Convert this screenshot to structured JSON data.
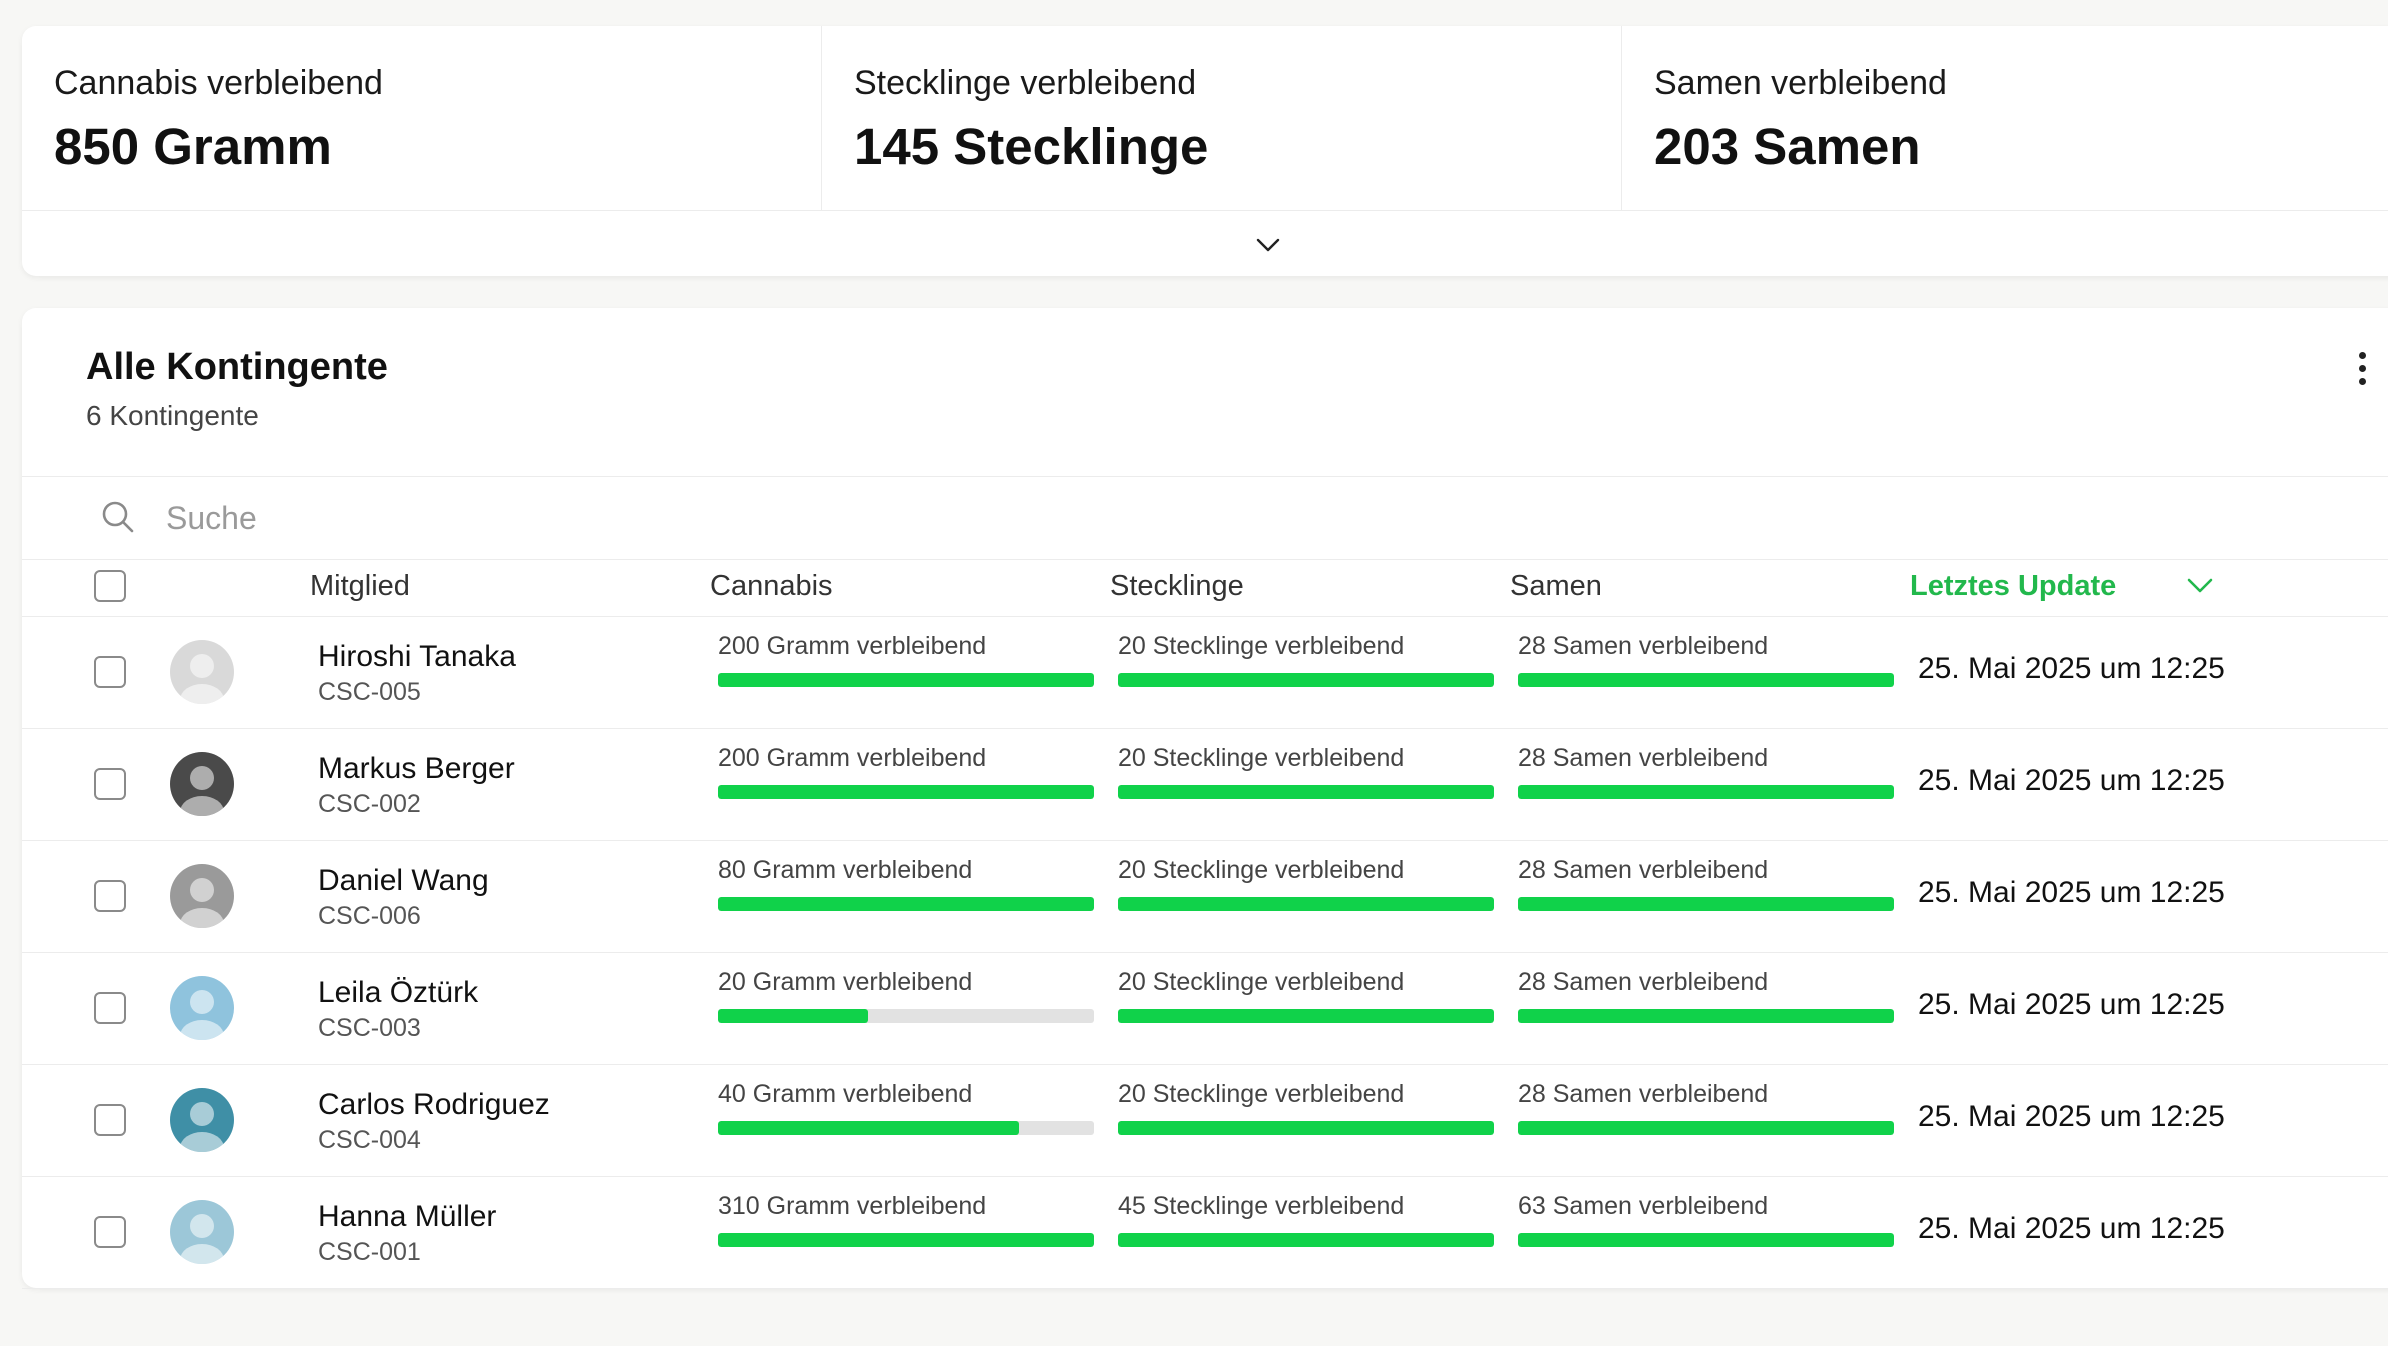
{
  "summary": {
    "stats": [
      {
        "label": "Cannabis verbleibend",
        "value": "850 Gramm"
      },
      {
        "label": "Stecklinge verbleibend",
        "value": "145 Stecklinge"
      },
      {
        "label": "Samen verbleibend",
        "value": "203 Samen"
      }
    ],
    "expand_icon": "chevron-down-icon"
  },
  "table_card": {
    "title": "Alle Kontingente",
    "subtitle": "6 Kontingente",
    "menu_icon": "kebab-menu-icon",
    "search": {
      "placeholder": "Suche",
      "value": ""
    },
    "columns": {
      "member": "Mitglied",
      "cannabis": "Cannabis",
      "stecklinge": "Stecklinge",
      "samen": "Samen",
      "last_update": "Letztes Update"
    },
    "sorted_column": "last_update",
    "rows": [
      {
        "name": "Hiroshi Tanaka",
        "code": "CSC-005",
        "cannabis": {
          "label": "200 Gramm verbleibend",
          "fill": 1.0
        },
        "stecklinge": {
          "label": "20 Stecklinge verbleibend",
          "fill": 1.0
        },
        "samen": {
          "label": "28 Samen verbleibend",
          "fill": 1.0
        },
        "date": "25. Mai 2025 um 12:25",
        "avatar_color": "#d9d9d9"
      },
      {
        "name": "Markus Berger",
        "code": "CSC-002",
        "cannabis": {
          "label": "200 Gramm verbleibend",
          "fill": 1.0
        },
        "stecklinge": {
          "label": "20 Stecklinge verbleibend",
          "fill": 1.0
        },
        "samen": {
          "label": "28 Samen verbleibend",
          "fill": 1.0
        },
        "date": "25. Mai 2025 um 12:25",
        "avatar_color": "#4a4a4a"
      },
      {
        "name": "Daniel Wang",
        "code": "CSC-006",
        "cannabis": {
          "label": "80 Gramm verbleibend",
          "fill": 1.0
        },
        "stecklinge": {
          "label": "20 Stecklinge verbleibend",
          "fill": 1.0
        },
        "samen": {
          "label": "28 Samen verbleibend",
          "fill": 1.0
        },
        "date": "25. Mai 2025 um 12:25",
        "avatar_color": "#9a9a9a"
      },
      {
        "name": "Leila Öztürk",
        "code": "CSC-003",
        "cannabis": {
          "label": "20 Gramm verbleibend",
          "fill": 0.4
        },
        "stecklinge": {
          "label": "20 Stecklinge verbleibend",
          "fill": 1.0
        },
        "samen": {
          "label": "28 Samen verbleibend",
          "fill": 1.0
        },
        "date": "25. Mai 2025 um 12:25",
        "avatar_color": "#8fc3dd"
      },
      {
        "name": "Carlos Rodriguez",
        "code": "CSC-004",
        "cannabis": {
          "label": "40 Gramm verbleibend",
          "fill": 0.8
        },
        "stecklinge": {
          "label": "20 Stecklinge verbleibend",
          "fill": 1.0
        },
        "samen": {
          "label": "28 Samen verbleibend",
          "fill": 1.0
        },
        "date": "25. Mai 2025 um 12:25",
        "avatar_color": "#3f8fa6"
      },
      {
        "name": "Hanna Müller",
        "code": "CSC-001",
        "cannabis": {
          "label": "310 Gramm verbleibend",
          "fill": 1.0
        },
        "stecklinge": {
          "label": "45 Stecklinge verbleibend",
          "fill": 1.0
        },
        "samen": {
          "label": "63 Samen verbleibend",
          "fill": 1.0
        },
        "date": "25. Mai 2025 um 12:25",
        "avatar_color": "#9cc7d8"
      }
    ]
  },
  "colors": {
    "accent_green": "#22b84c",
    "bar_green": "#10d24a",
    "bar_track": "#e2e2e2"
  }
}
